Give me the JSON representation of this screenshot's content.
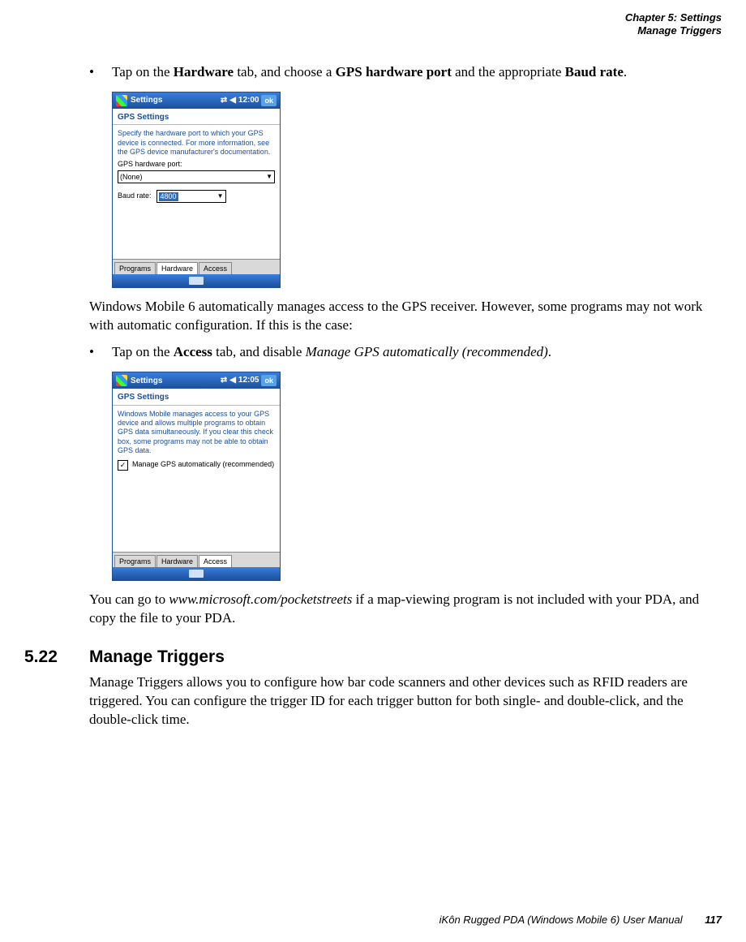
{
  "header": {
    "chapter_line": "Chapter 5: Settings",
    "section_line": "Manage Triggers"
  },
  "body": {
    "bullet1_prefix": "Tap on the ",
    "bullet1_b1": "Hardware",
    "bullet1_mid1": " tab, and choose a ",
    "bullet1_b2": "GPS hardware port",
    "bullet1_mid2": " and the appropriate ",
    "bullet1_b3": "Baud rate",
    "bullet1_suffix": ".",
    "para_after_ss1": "Windows Mobile 6 automatically manages access to the GPS receiver. However, some programs may not work with automatic configuration. If this is the case:",
    "bullet2_prefix": "Tap on the ",
    "bullet2_b1": "Access",
    "bullet2_mid1": " tab, and disable ",
    "bullet2_i1": "Manage GPS automatically (recommended)",
    "bullet2_suffix": ".",
    "para_after_ss2_a": "You can go to ",
    "para_after_ss2_link": "www.microsoft.com/pocketstreets",
    "para_after_ss2_b": " if a map-viewing program is not included with your PDA, and copy the file to your PDA.",
    "heading_num": "5.22",
    "heading_text": "Manage Triggers",
    "heading_para": "Manage Triggers allows you to configure how bar code scanners and other devices such as RFID readers are triggered. You can configure the trigger ID for each trigger button for both single- and double-click, and the double-click time."
  },
  "screenshot1": {
    "titlebar": "Settings",
    "time": "12:00",
    "ok": "ok",
    "panel_title": "GPS Settings",
    "desc": "Specify the hardware port to which your GPS device is connected. For more information, see the GPS device manufacturer's documentation.",
    "label_port": "GPS hardware port:",
    "port_value": "(None)",
    "label_baud": "Baud rate:",
    "baud_value": "4800",
    "tabs": [
      "Programs",
      "Hardware",
      "Access"
    ],
    "active_tab": "Hardware"
  },
  "screenshot2": {
    "titlebar": "Settings",
    "time": "12:05",
    "ok": "ok",
    "panel_title": "GPS Settings",
    "desc": "Windows Mobile manages access to your GPS device and allows multiple programs to obtain GPS data simultaneously. If you clear this check box, some programs may not be able to obtain GPS data.",
    "checkbox_label": "Manage GPS automatically (recommended)",
    "checkbox_checked": true,
    "tabs": [
      "Programs",
      "Hardware",
      "Access"
    ],
    "active_tab": "Access"
  },
  "footer": {
    "manual": "iKôn Rugged PDA (Windows Mobile 6) User Manual",
    "page": "117"
  }
}
